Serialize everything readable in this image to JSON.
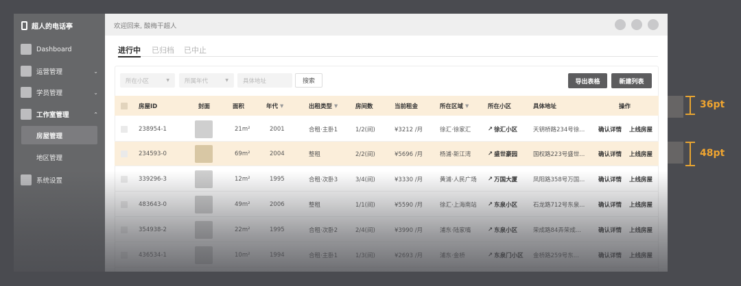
{
  "app": {
    "name": "超人的电话亭",
    "welcome": "欢迎回来, 酸梅干超人",
    "logo_icon": "logo-mark-icon"
  },
  "sidebar": {
    "items": [
      {
        "label": "Dashboard",
        "icon": "dashboard-icon"
      },
      {
        "label": "运营管理",
        "icon": "operations-icon",
        "chevron": "⌄"
      },
      {
        "label": "学员管理",
        "icon": "students-icon",
        "chevron": "⌄"
      },
      {
        "label": "工作室管理",
        "icon": "studio-icon",
        "chevron": "⌃"
      },
      {
        "label": "系统设置",
        "icon": "settings-icon"
      }
    ],
    "sub_items": [
      {
        "label": "房屋管理",
        "active": true
      },
      {
        "label": "地区管理",
        "active": false
      }
    ]
  },
  "tabs": [
    {
      "label": "进行中",
      "active": true
    },
    {
      "label": "已归档",
      "active": false
    },
    {
      "label": "已中止",
      "active": false
    }
  ],
  "filters": {
    "community_placeholder": "所在小区",
    "era_placeholder": "所属年代",
    "address_placeholder": "具体地址",
    "search_label": "搜索",
    "export_label": "导出表格",
    "new_label": "新建列表"
  },
  "table": {
    "columns": [
      "房屋ID",
      "封面",
      "面积",
      "年代",
      "出租类型",
      "房间数",
      "当前租金",
      "所在区域",
      "所在小区",
      "具体地址",
      "操作"
    ],
    "rows": [
      {
        "id": "238954-1",
        "area": "21m²",
        "year": "2001",
        "type": "合租·主卧1",
        "rooms": "1/2(间)",
        "rent": "¥3212 /月",
        "region": "徐汇·徐家汇",
        "community": "徐汇小区",
        "address": "天钥桥路234号徐...",
        "action1": "确认详情",
        "action2": "上线房屋"
      },
      {
        "id": "234593-0",
        "area": "69m²",
        "year": "2004",
        "type": "整租",
        "rooms": "2/2(间)",
        "rent": "¥5696 /月",
        "region": "杨浦·新江湾",
        "community": "盛世豪园",
        "address": "国权路223号盛世...",
        "action1": "确认详情",
        "action2": "上线房屋"
      },
      {
        "id": "339296-3",
        "area": "12m²",
        "year": "1995",
        "type": "合租·次卧3",
        "rooms": "3/4(间)",
        "rent": "¥3330 /月",
        "region": "黄浦·人民广场",
        "community": "万国大厦",
        "address": "凤阳路358号万国...",
        "action1": "确认详情",
        "action2": "上线房屋"
      },
      {
        "id": "483643-0",
        "area": "49m²",
        "year": "2006",
        "type": "整租",
        "rooms": "1/1(间)",
        "rent": "¥5590 /月",
        "region": "徐汇·上海南站",
        "community": "东泉小区",
        "address": "石龙路712号东泉...",
        "action1": "确认详情",
        "action2": "上线房屋"
      },
      {
        "id": "354938-2",
        "area": "22m²",
        "year": "1995",
        "type": "合租·次卧2",
        "rooms": "2/4(间)",
        "rent": "¥3990 /月",
        "region": "浦东·陆家嘴",
        "community": "东泉小区",
        "address": "荣成路84弄荣成...",
        "action1": "确认详情",
        "action2": "上线房屋"
      },
      {
        "id": "436534-1",
        "area": "10m²",
        "year": "1994",
        "type": "合租·主卧1",
        "rooms": "1/3(间)",
        "rent": "¥2693 /月",
        "region": "浦东·金桥",
        "community": "东泉门小区",
        "address": "金桥路259号东...",
        "action1": "确认详情",
        "action2": "上线房屋"
      }
    ]
  },
  "annotations": {
    "header_height": "36pt",
    "row_height": "48pt",
    "accent_color": "#e9a531"
  }
}
